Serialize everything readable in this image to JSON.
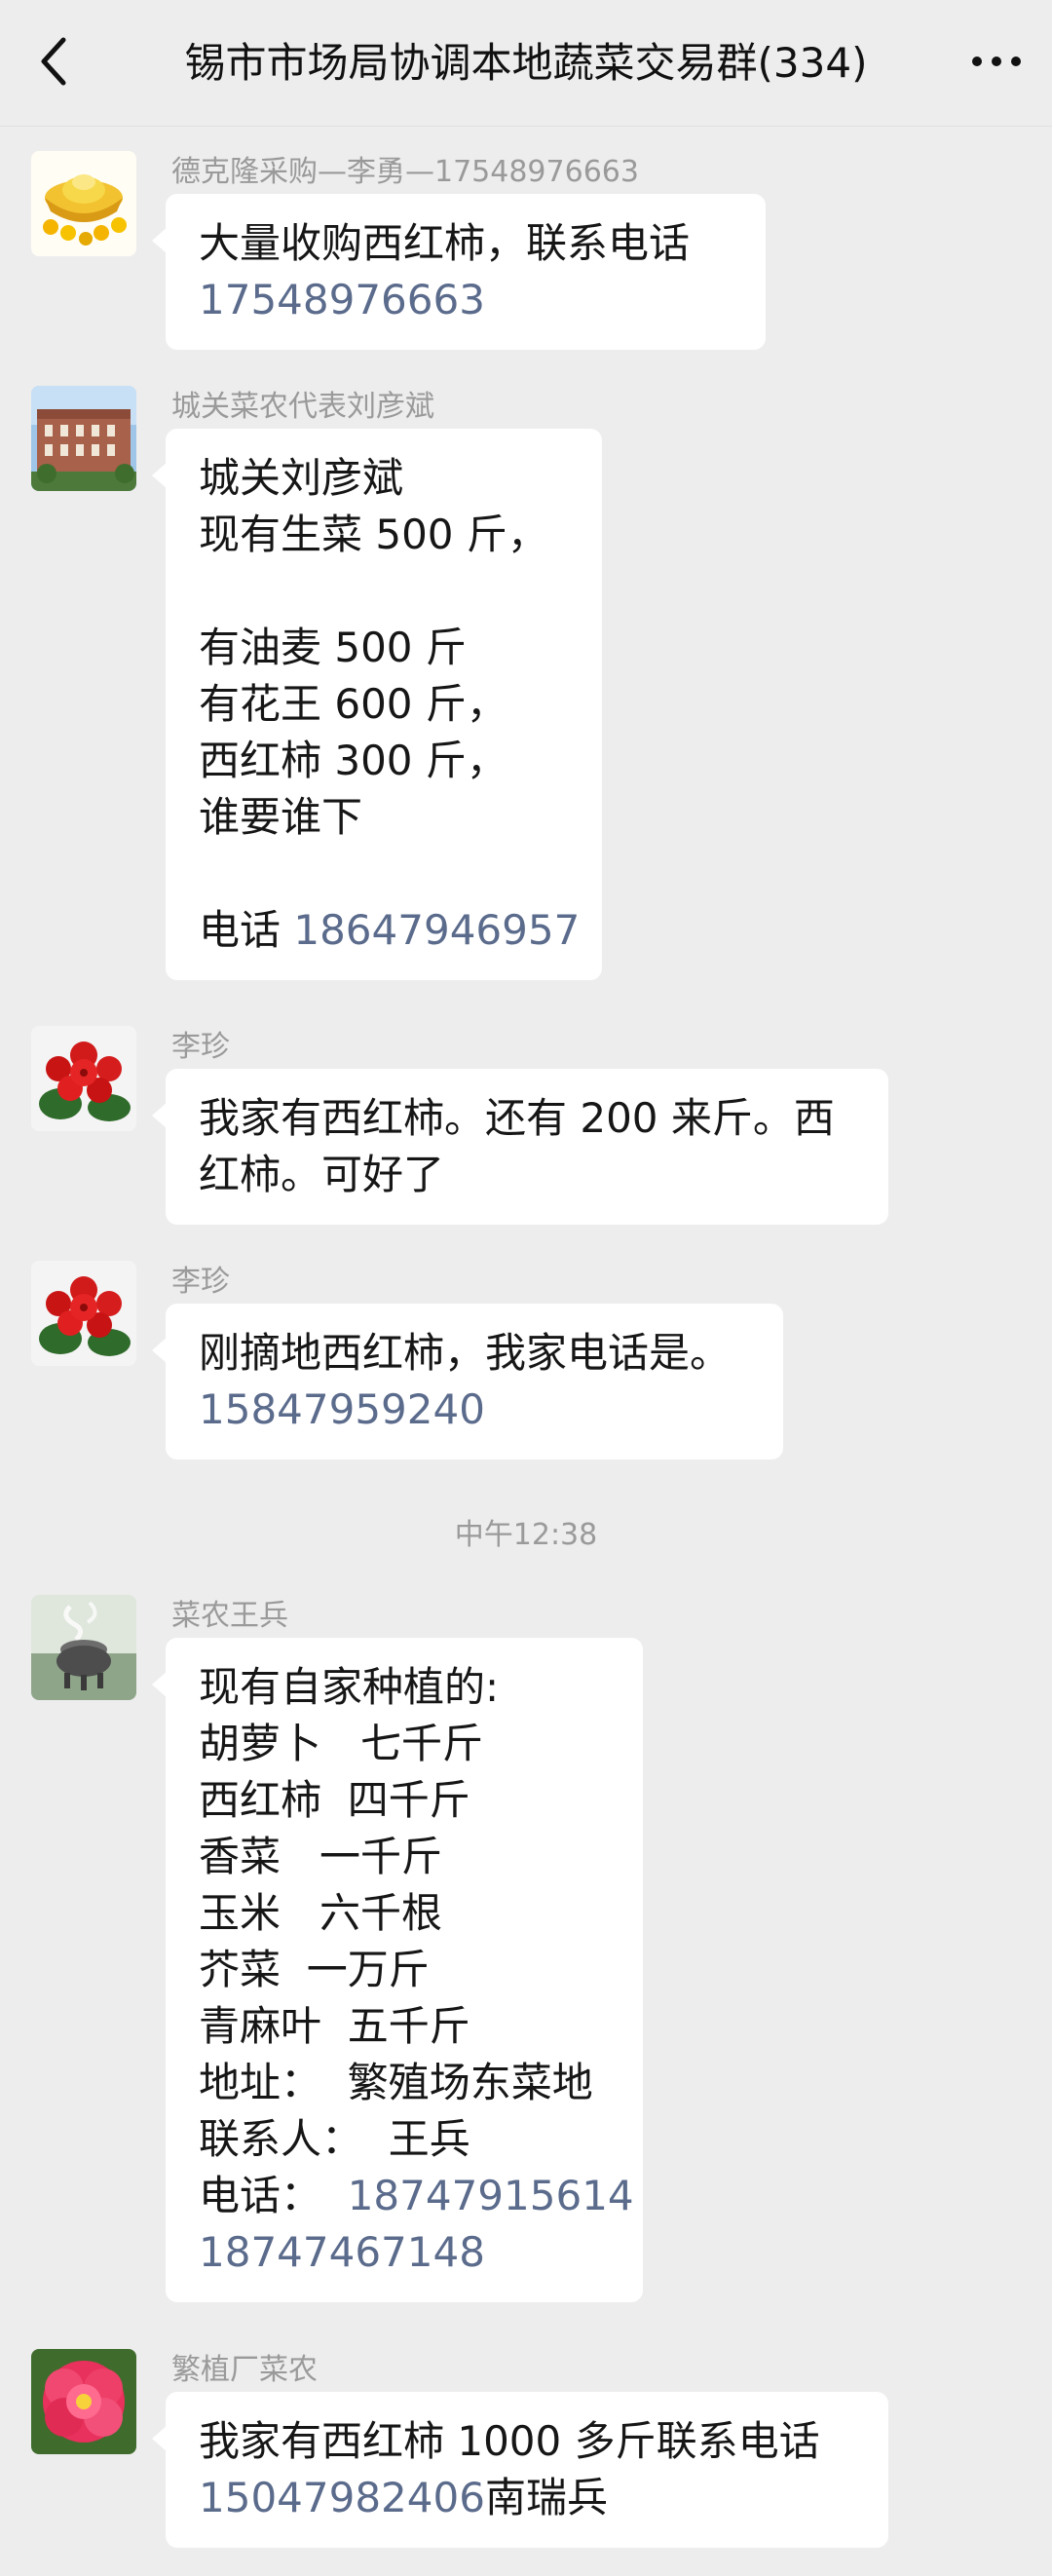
{
  "header": {
    "title": "锡市市场局协调本地蔬菜交易群(334)",
    "back_icon": "chevron-left-icon",
    "more_icon": "more-dots-icon"
  },
  "messages": [
    {
      "sender": "德克隆采购—李勇—17548976663",
      "avatar": "gold-ingot-avatar",
      "lines": [
        {
          "text": "大量收购西红柿，联系电话",
          "phone": ""
        },
        {
          "text": "",
          "phone": "17548976663"
        }
      ]
    },
    {
      "sender": "城关菜农代表刘彦斌",
      "avatar": "building-avatar",
      "lines": [
        {
          "text": "城关刘彦斌",
          "phone": ""
        },
        {
          "text": "现有生菜 500 斤，",
          "phone": ""
        },
        {
          "text": "",
          "phone": ""
        },
        {
          "text": "有油麦 500 斤",
          "phone": ""
        },
        {
          "text": "有花王 600 斤，",
          "phone": ""
        },
        {
          "text": "西红柿 300 斤，",
          "phone": ""
        },
        {
          "text": "谁要谁下",
          "phone": ""
        },
        {
          "text": "",
          "phone": ""
        },
        {
          "text": "电话 ",
          "phone": "18647946957"
        }
      ]
    },
    {
      "sender": "李珍",
      "avatar": "red-flower-avatar",
      "lines": [
        {
          "text": "我家有西红柿。还有 200 来斤。西",
          "phone": ""
        },
        {
          "text": "红柿。可好了",
          "phone": ""
        }
      ]
    },
    {
      "sender": "李珍",
      "avatar": "red-flower-avatar",
      "lines": [
        {
          "text": "刚摘地西红柿，我家电话是。",
          "phone": ""
        },
        {
          "text": "",
          "phone": "15847959240"
        }
      ]
    },
    {
      "sender": "菜农王兵",
      "avatar": "incense-burner-avatar",
      "lines": [
        {
          "text": "现有自家种植的:",
          "phone": ""
        },
        {
          "text": "胡萝卜   七千斤",
          "phone": ""
        },
        {
          "text": "西红柿  四千斤",
          "phone": ""
        },
        {
          "text": "香菜   一千斤",
          "phone": ""
        },
        {
          "text": "玉米   六千根",
          "phone": ""
        },
        {
          "text": "芥菜  一万斤",
          "phone": ""
        },
        {
          "text": "青麻叶  五千斤",
          "phone": ""
        },
        {
          "text": "地址：  繁殖场东菜地",
          "phone": ""
        },
        {
          "text": "联系人：  王兵",
          "phone": ""
        },
        {
          "text": "电话：  ",
          "phone": "18747915614"
        },
        {
          "text": "",
          "phone": "18747467148"
        }
      ]
    },
    {
      "sender": "繁植厂菜农",
      "avatar": "pink-flower-avatar",
      "lines": [
        {
          "text": "我家有西红柿 1000 多斤联系电话",
          "phone": ""
        },
        {
          "text": "",
          "phone": "15047982406",
          "after": "南瑞兵"
        }
      ]
    }
  ],
  "time_separator": "中午12:38",
  "colors": {
    "background": "#ededed",
    "bubble": "#ffffff",
    "phone_link": "#5b6b8c",
    "sender_name": "#9a9a9a"
  }
}
